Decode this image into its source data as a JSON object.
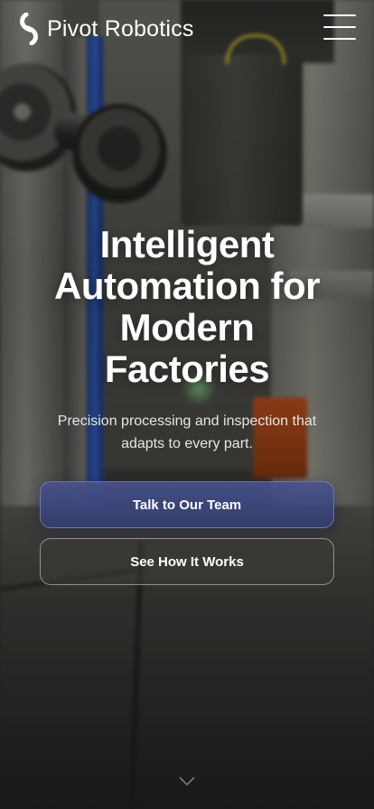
{
  "header": {
    "brand_name": "Pivot Robotics",
    "logo_icon": "pivot-logo-icon",
    "menu_icon": "hamburger-menu-icon"
  },
  "hero": {
    "headline": "Intelligent Automation for Modern Factories",
    "subheadline": "Precision processing and inspection that adapts to every part.",
    "primary_cta": "Talk to Our Team",
    "secondary_cta": "See How It Works",
    "scroll_icon": "chevron-down-icon",
    "background_image": "factory-machine-photo"
  },
  "colors": {
    "text": "#ffffff",
    "primary_button": "#3d4680",
    "secondary_button_border": "#ffffff"
  }
}
